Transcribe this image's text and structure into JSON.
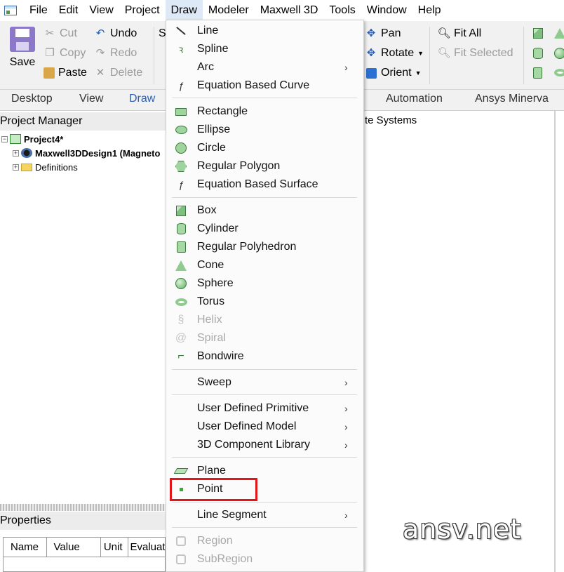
{
  "menubar": {
    "items": [
      "File",
      "Edit",
      "View",
      "Project",
      "Draw",
      "Modeler",
      "Maxwell 3D",
      "Tools",
      "Window",
      "Help"
    ]
  },
  "ribbon": {
    "save": "Save",
    "cut": "Cut",
    "copy": "Copy",
    "paste": "Paste",
    "undo": "Undo",
    "redo": "Redo",
    "delete": "Delete",
    "partial_s": "S",
    "pan": "Pan",
    "rotate": "Rotate",
    "orient": "Orient",
    "fit_all": "Fit All",
    "fit_selected": "Fit Selected"
  },
  "tabs": [
    "Desktop",
    "View",
    "Draw",
    "Automation",
    "Ansys Minerva"
  ],
  "project_manager": {
    "title": "Project Manager",
    "project": "Project4*",
    "design": "Maxwell3DDesign1 (Magneto",
    "definitions": "Definitions"
  },
  "properties": {
    "title": "Properties",
    "columns": [
      "Name",
      "Value",
      "Unit",
      "Evaluat"
    ]
  },
  "coordinate_systems_partial": "te Systems",
  "watermark": "ansv.net",
  "draw_menu": {
    "line": "Line",
    "spline": "Spline",
    "arc": "Arc",
    "equation_curve": "Equation Based Curve",
    "rectangle": "Rectangle",
    "ellipse": "Ellipse",
    "circle": "Circle",
    "regular_polygon": "Regular Polygon",
    "equation_surface": "Equation Based Surface",
    "box": "Box",
    "cylinder": "Cylinder",
    "regular_polyhedron": "Regular Polyhedron",
    "cone": "Cone",
    "sphere": "Sphere",
    "torus": "Torus",
    "helix": "Helix",
    "spiral": "Spiral",
    "bondwire": "Bondwire",
    "sweep": "Sweep",
    "udp": "User Defined Primitive",
    "udm": "User Defined Model",
    "component_library": "3D Component Library",
    "plane": "Plane",
    "point": "Point",
    "line_segment": "Line Segment",
    "region": "Region",
    "subregion": "SubRegion",
    "submenu_arrow": "›"
  },
  "colors": {
    "highlight_box": "#e0161b",
    "active_tab": "#2b5fb5",
    "point_icon": "#3ea33e"
  }
}
